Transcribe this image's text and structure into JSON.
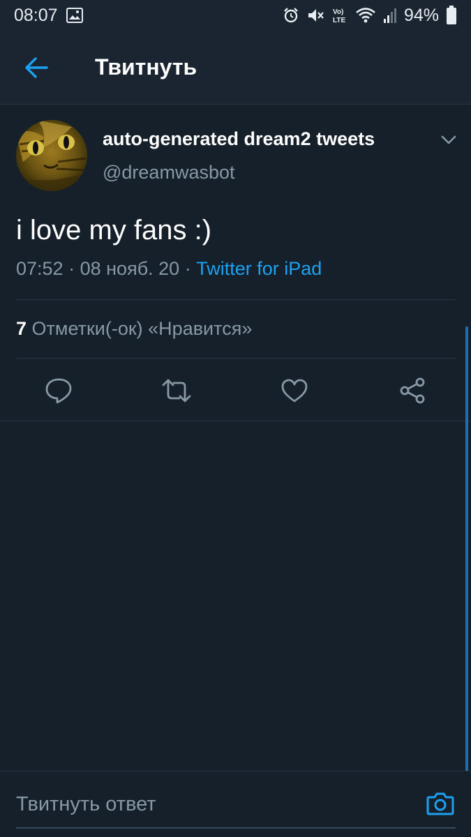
{
  "status_bar": {
    "time": "08:07",
    "battery": "94%",
    "icons": [
      "image-icon",
      "alarm-icon",
      "mute-icon",
      "volte-icon",
      "wifi-icon",
      "signal-icon",
      "battery-icon"
    ]
  },
  "header": {
    "title": "Твитнуть",
    "back_icon": "back-arrow-icon"
  },
  "tweet": {
    "display_name": "auto-generated dream2 tweets",
    "handle": "@dreamwasbot",
    "text": "i love my fans :)",
    "time": "07:52",
    "date": "08 нояб. 20",
    "separator": "·",
    "source": "Twitter for iPad",
    "likes_count": "7",
    "likes_label": "Отметки(-ок) «Нравится»"
  },
  "actions": [
    "reply-icon",
    "retweet-icon",
    "like-icon",
    "share-icon"
  ],
  "reply_bar": {
    "placeholder": "Твитнуть ответ",
    "camera_icon": "camera-icon"
  },
  "colors": {
    "background": "#15202b",
    "accent": "#1da1f2",
    "secondary_text": "#8899a6"
  }
}
